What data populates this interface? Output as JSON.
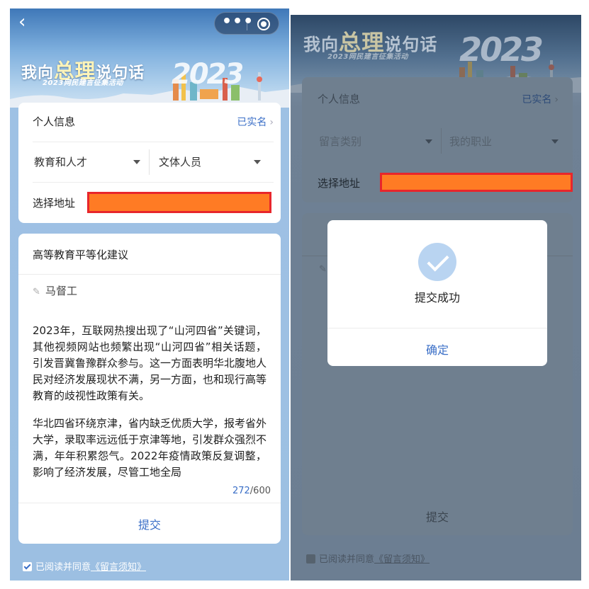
{
  "banner": {
    "title_part1": "我向",
    "title_part2": "总理",
    "title_part3": "说句话",
    "subtitle": "2023网民建言征集活动",
    "year": "2023"
  },
  "left": {
    "nav": {
      "back_icon": "back-chevron-icon",
      "more_icon": "more-dots-icon",
      "close_icon": "target-close-icon"
    },
    "personal_info": {
      "label": "个人信息",
      "verified_link": "已实名",
      "category_value": "教育和人才",
      "occupation_value": "文体人员",
      "address_label": "选择地址"
    },
    "message": {
      "title": "高等教育平等化建议",
      "author": "马督工",
      "paragraph1": "2023年，互联网热搜出现了“山河四省”关键词，其他视频网站也频繁出现“山河四省”相关话题，引发晋冀鲁豫群众参与。这一方面表明华北腹地人民对经济发展现状不满，另一方面，也和现行高等教育的歧视性政策有关。",
      "paragraph2": "华北四省环绕京津，省内缺乏优质大学，报考省外大学，录取率远远低于京津等地，引发群众强烈不满，年年积累怨气。2022年疫情政策反复调整，影响了经济发展，尽管工地全局",
      "char_count": "272",
      "char_limit": "/600",
      "submit_label": "提交"
    },
    "agreement": {
      "prefix": "已阅读并同意",
      "link": "《留言须知》"
    }
  },
  "right": {
    "personal_info": {
      "label": "个人信息",
      "verified_link": "已实名",
      "category_placeholder": "留言类别",
      "occupation_placeholder": "我的职业",
      "address_label": "选择地址"
    },
    "submit_label": "提交",
    "agreement": {
      "prefix": "已阅读并同意",
      "link": "《留言须知》"
    },
    "modal": {
      "icon": "success-check-icon",
      "message": "提交成功",
      "confirm_label": "确定"
    }
  },
  "colors": {
    "accent": "#3b6fc7",
    "redaction_fill": "#ff7b24",
    "redaction_border": "#e8262b"
  }
}
